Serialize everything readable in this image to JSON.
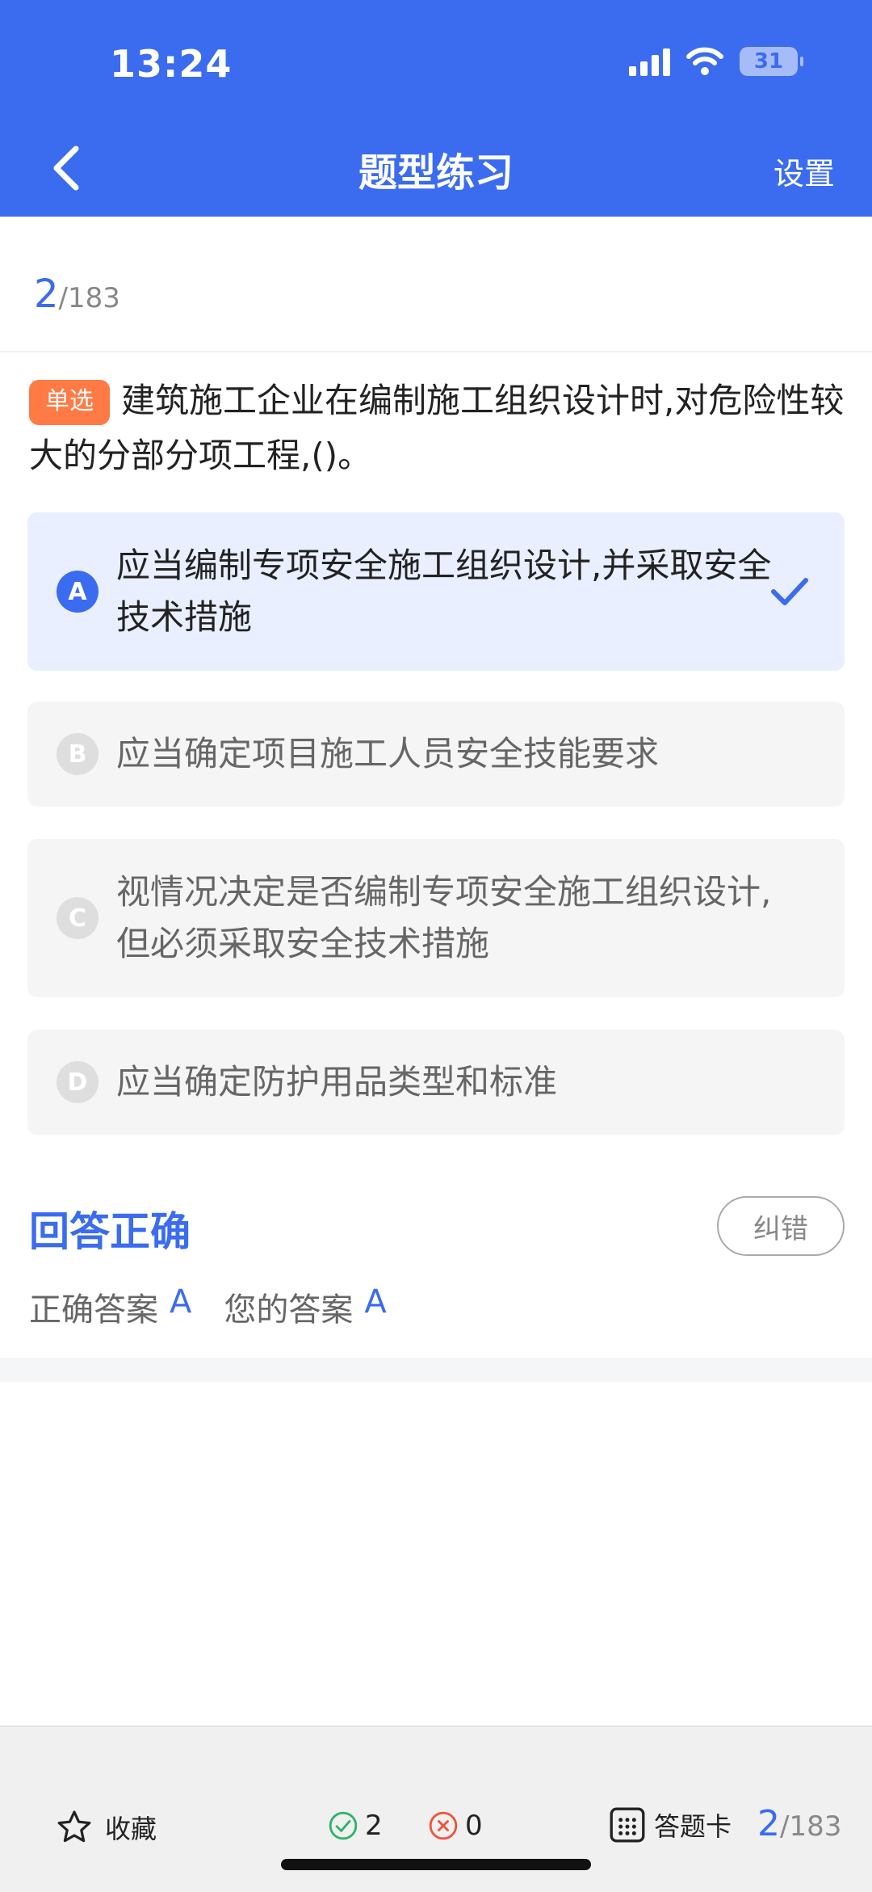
{
  "status_bar": {
    "time": "13:24",
    "battery": "31"
  },
  "nav": {
    "title": "题型练习",
    "settings_label": "设置"
  },
  "progress": {
    "current": "2",
    "total": "/183"
  },
  "question": {
    "type_badge": "单选",
    "text": "建筑施工企业在编制施工组织设计时,对危险性较大的分部分项工程,()。"
  },
  "options": [
    {
      "letter": "A",
      "text": "应当编制专项安全施工组织设计,并采取安全技术措施",
      "selected": true
    },
    {
      "letter": "B",
      "text": "应当确定项目施工人员安全技能要求",
      "selected": false
    },
    {
      "letter": "C",
      "text": "视情况决定是否编制专项安全施工组织设计,但必须采取安全技术措施",
      "selected": false
    },
    {
      "letter": "D",
      "text": "应当确定防护用品类型和标准",
      "selected": false
    }
  ],
  "result": {
    "title": "回答正确",
    "report_button": "纠错",
    "correct_label": "正确答案",
    "correct_value": "A",
    "yours_label": "您的答案",
    "yours_value": "A"
  },
  "footer": {
    "favorite_label": "收藏",
    "right_count": "2",
    "wrong_count": "0",
    "answer_card_label": "答题卡",
    "current": "2",
    "total": "/183"
  },
  "colors": {
    "primary": "#3b6cf0",
    "badge": "#ff7a45",
    "right": "#2fb36b",
    "wrong": "#f0533a"
  }
}
